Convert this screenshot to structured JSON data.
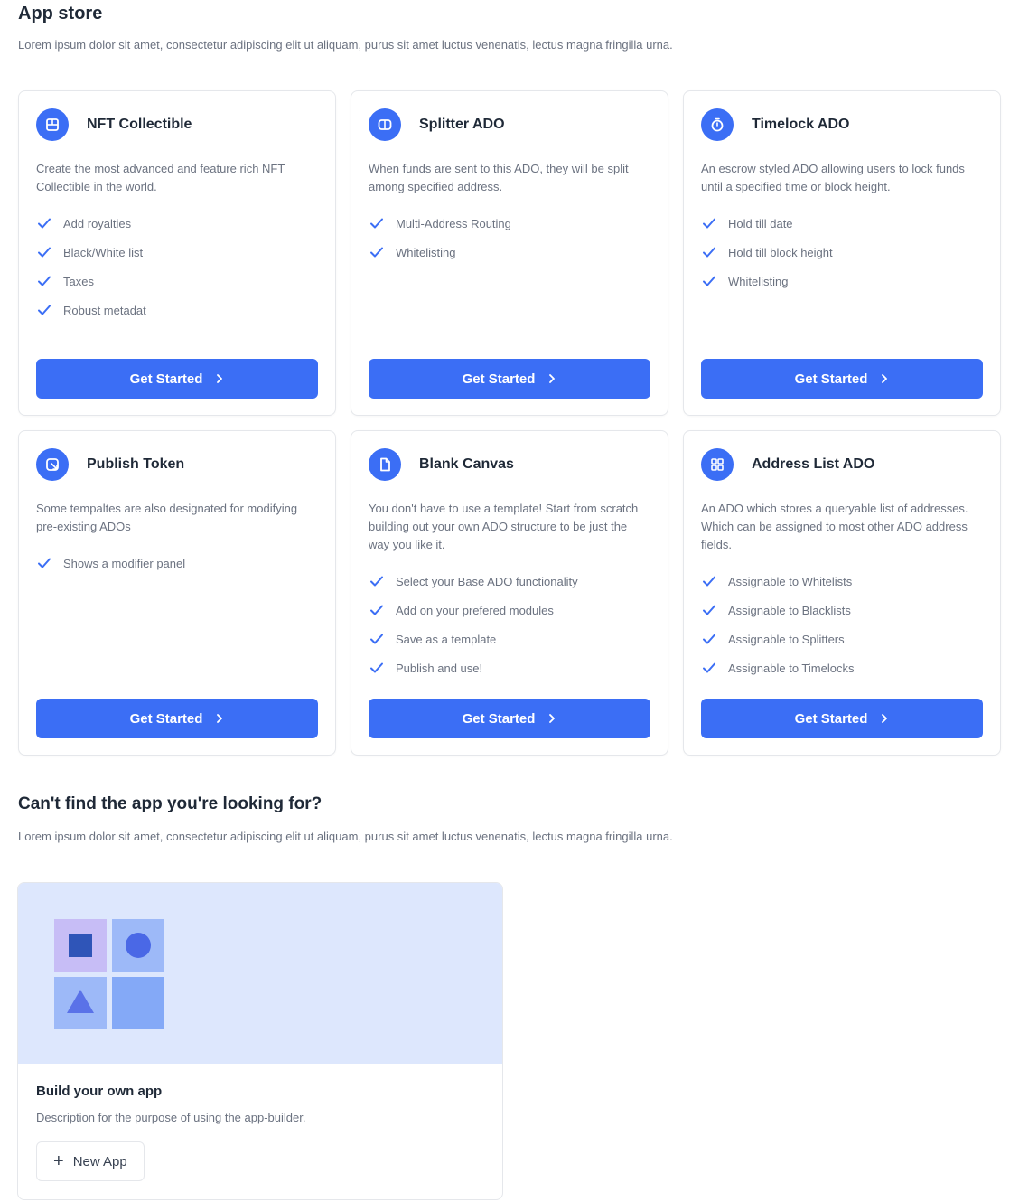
{
  "header": {
    "title": "App store",
    "description": "Lorem ipsum dolor sit amet, consectetur adipiscing elit ut aliquam, purus sit amet luctus venenatis, lectus magna fringilla urna."
  },
  "apps": [
    {
      "title": "NFT Collectible",
      "icon": "image-icon",
      "description": "Create the most advanced and feature rich NFT Collectible in the world.",
      "features": [
        "Add royalties",
        "Black/White list",
        "Taxes",
        "Robust metadat"
      ],
      "button_label": "Get Started"
    },
    {
      "title": "Splitter ADO",
      "icon": "split-icon",
      "description": "When funds are sent to this ADO, they will be split among specified address.",
      "features": [
        "Multi-Address Routing",
        "Whitelisting"
      ],
      "button_label": "Get Started"
    },
    {
      "title": "Timelock ADO",
      "icon": "timer-icon",
      "description": "An escrow styled ADO allowing users to lock funds until a specified time or block height.",
      "features": [
        "Hold till date",
        "Hold till block height",
        "Whitelisting"
      ],
      "button_label": "Get Started"
    },
    {
      "title": "Publish Token",
      "icon": "publish-icon",
      "description": "Some tempaltes are also designated for modifying pre-existing ADOs",
      "features": [
        "Shows a modifier panel"
      ],
      "button_label": "Get Started"
    },
    {
      "title": "Blank Canvas",
      "icon": "document-icon",
      "description": "You don't have to use a template! Start from scratch building out your own ADO structure to be just the way you like it.",
      "features": [
        "Select your Base ADO functionality",
        "Add on your prefered modules",
        "Save as a template",
        "Publish and use!"
      ],
      "button_label": "Get Started"
    },
    {
      "title": "Address List ADO",
      "icon": "list-icon",
      "description": "An ADO which stores a queryable list of addresses. Which can be assigned to most other ADO address fields.",
      "features": [
        "Assignable to Whitelists",
        "Assignable to Blacklists",
        "Assignable to Splitters",
        "Assignable to Timelocks"
      ],
      "button_label": "Get Started"
    }
  ],
  "not_found": {
    "title": "Can't find the app you're looking for?",
    "description": "Lorem ipsum dolor sit amet, consectetur adipiscing elit ut aliquam, purus sit amet luctus venenatis, lectus magna fringilla urna."
  },
  "builder": {
    "title": "Build your own app",
    "description": "Description for the purpose of using the app-builder.",
    "button_label": "New App",
    "button_icon": "plus-icon"
  },
  "colors": {
    "accent": "#3b6ef5",
    "banner": "#dde7fd",
    "text": "#1f2937",
    "muted": "#6b7280",
    "border": "#e5e7eb"
  }
}
